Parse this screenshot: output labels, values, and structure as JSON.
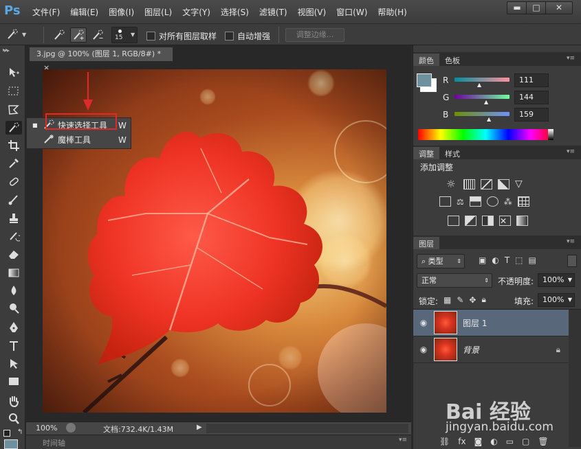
{
  "app": {
    "logo": "Ps"
  },
  "menu": [
    "文件(F)",
    "编辑(E)",
    "图像(I)",
    "图层(L)",
    "文字(Y)",
    "选择(S)",
    "滤镜(T)",
    "视图(V)",
    "窗口(W)",
    "帮助(H)"
  ],
  "window_controls": {
    "minimize": "▬",
    "maximize": "□",
    "close": "✕"
  },
  "options": {
    "brush_size": "15",
    "sample_all_layers": "对所有图层取样",
    "auto_enhance": "自动增强",
    "refine_edge": "调整边缘..."
  },
  "document": {
    "tab_title": "3.jpg @ 100% (图层 1, RGB/8#) *",
    "tab_close": "×",
    "zoom": "100%",
    "doc_info": "文档:732.4K/1.43M",
    "timeline": "时间轴"
  },
  "flyout": {
    "items": [
      {
        "label": "快速选择工具",
        "shortcut": "W",
        "selected": true
      },
      {
        "label": "魔棒工具",
        "shortcut": "W",
        "selected": false
      }
    ]
  },
  "color_panel": {
    "tabs": [
      "颜色",
      "色板"
    ],
    "channels": [
      {
        "name": "R",
        "value": "111"
      },
      {
        "name": "G",
        "value": "144"
      },
      {
        "name": "B",
        "value": "159"
      }
    ],
    "swatch_color": "#6f909f"
  },
  "adjust_panel": {
    "tabs": [
      "调整",
      "样式"
    ],
    "title": "添加调整"
  },
  "layers_panel": {
    "tab": "图层",
    "filter": "类型",
    "blend_mode": "正常",
    "opacity_label": "不透明度:",
    "opacity_value": "100%",
    "lock_label": "锁定:",
    "fill_label": "填充:",
    "fill_value": "100%",
    "layers": [
      {
        "name": "图层 1",
        "selected": true,
        "locked": false
      },
      {
        "name": "背景",
        "selected": false,
        "locked": true
      }
    ]
  },
  "watermark": {
    "brand": "Bai 经验",
    "url": "jingyan.baidu.com"
  }
}
